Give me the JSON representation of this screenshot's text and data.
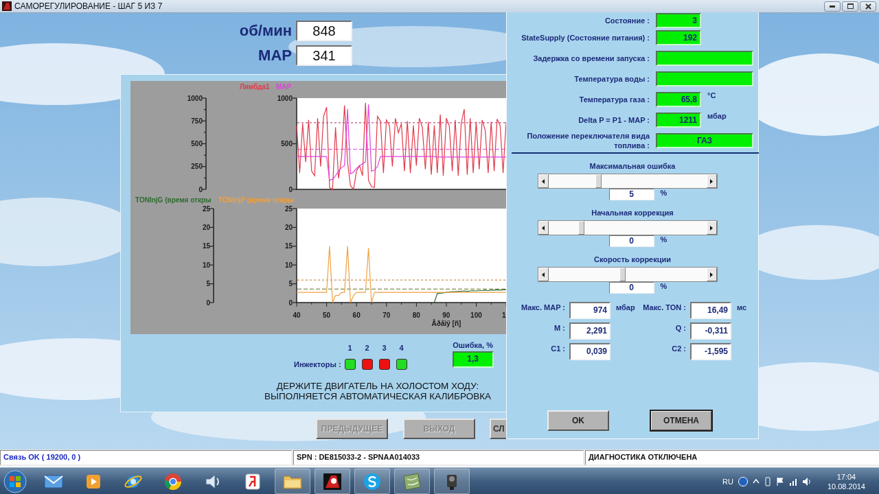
{
  "window": {
    "title": "САМОРЕГУЛИРОВАНИЕ - ШАГ 5 ИЗ 7"
  },
  "readouts": [
    {
      "label": "об/мин",
      "value": "848"
    },
    {
      "label": "MAP",
      "value": "341"
    }
  ],
  "charts": [
    {
      "left_axis": [
        "1000",
        "750",
        "500",
        "250",
        "0"
      ],
      "chart_data": {
        "type": "line",
        "xlim": [
          40,
          110
        ],
        "ylim": [
          0,
          1000
        ],
        "yticks": [
          0,
          500,
          1000
        ],
        "ref_lines": [
          {
            "axis": "y",
            "value": 730,
            "color": "#b02060"
          },
          {
            "axis": "y",
            "value": 440,
            "color": "#e040e0"
          }
        ],
        "x": [
          40,
          41,
          42,
          43,
          44,
          45,
          46,
          47,
          48,
          49,
          50,
          51,
          52,
          53,
          54,
          55,
          56,
          57,
          58,
          59,
          60,
          61,
          62,
          63,
          64,
          65,
          66,
          67,
          68,
          69,
          70,
          71,
          72,
          73,
          74,
          75,
          76,
          77,
          78,
          79,
          80,
          81,
          82,
          83,
          84,
          85,
          86,
          87,
          88,
          89,
          90,
          91,
          92,
          93,
          94,
          95,
          96,
          97,
          98,
          99,
          100,
          101,
          102,
          103,
          104,
          105,
          106,
          107,
          108,
          109,
          110
        ],
        "series": [
          {
            "name": "Лямбда1",
            "color": "#e03a4a",
            "values": [
              700,
              180,
              720,
              300,
              760,
              200,
              150,
              780,
              250,
              800,
              900,
              20,
              0,
              680,
              120,
              350,
              920,
              300,
              40,
              0,
              200,
              260,
              150,
              950,
              100,
              30,
              20,
              800,
              750,
              180,
              760,
              700,
              250,
              780,
              620,
              720,
              200,
              750,
              180,
              700,
              260,
              780,
              680,
              220,
              740,
              160,
              700,
              180,
              820,
              150,
              780,
              700,
              200,
              760,
              150,
              720,
              880,
              160,
              780,
              180,
              740,
              220,
              760,
              650,
              180,
              740,
              200,
              770,
              700,
              180,
              740
            ]
          },
          {
            "name": "MAP",
            "color": "#e040e0",
            "values": [
              360,
              360,
              360,
              360,
              360,
              360,
              360,
              360,
              360,
              360,
              360,
              100,
              110,
              150,
              200,
              240,
              260,
              880,
              170,
              190,
              230,
              260,
              280,
              300,
              930,
              200,
              210,
              250,
              360,
              360,
              360,
              360,
              360,
              360,
              360,
              360,
              360,
              360,
              360,
              360,
              360,
              360,
              360,
              360,
              360,
              360,
              360,
              355,
              355,
              355,
              355,
              355,
              355,
              355,
              355,
              355,
              355,
              355,
              355,
              355,
              355,
              355,
              355,
              355,
              355,
              355,
              355,
              355,
              355,
              355,
              355
            ]
          }
        ]
      }
    },
    {
      "left_axis": [
        "25",
        "20",
        "15",
        "10",
        "5",
        "0"
      ],
      "cut_tick_label": "1",
      "chart_data": {
        "type": "line",
        "xlabel": "Âðåìÿ [ñ]",
        "xlim": [
          40,
          110
        ],
        "ylim": [
          0,
          25
        ],
        "yticks": [
          0,
          5,
          10,
          15,
          20,
          25
        ],
        "ref_lines": [
          {
            "axis": "y",
            "value": 6,
            "color": "#c07020"
          },
          {
            "axis": "y",
            "value": 3.6,
            "color": "#607020"
          }
        ],
        "xticks": [
          40,
          50,
          60,
          70,
          80,
          90,
          100
        ],
        "x": [
          40,
          41,
          42,
          43,
          44,
          45,
          46,
          47,
          48,
          49,
          50,
          51,
          52,
          53,
          54,
          55,
          56,
          57,
          58,
          59,
          60,
          61,
          62,
          63,
          64,
          65,
          66,
          67,
          68,
          69,
          70,
          71,
          72,
          73,
          74,
          75,
          76,
          77,
          78,
          79,
          80,
          81,
          82,
          83,
          84,
          85,
          86,
          87,
          88,
          89,
          90,
          91,
          92,
          93,
          94,
          95,
          96,
          97,
          98,
          99,
          100,
          101,
          102,
          103,
          104,
          105,
          106,
          107,
          108,
          109,
          110
        ],
        "series": [
          {
            "name": "TONInjG (время откры",
            "color": "#2e6b2e",
            "values": [
              null,
              null,
              null,
              null,
              null,
              null,
              null,
              null,
              null,
              null,
              null,
              null,
              null,
              null,
              null,
              null,
              null,
              null,
              null,
              null,
              null,
              null,
              null,
              null,
              null,
              null,
              null,
              null,
              null,
              null,
              null,
              null,
              null,
              null,
              null,
              null,
              null,
              null,
              null,
              null,
              null,
              null,
              null,
              null,
              null,
              null,
              0,
              2.4,
              2.5,
              2.6,
              2.7,
              2.8,
              2.9,
              2.9,
              3,
              3,
              3.1,
              3,
              3.1,
              3.2,
              3.1,
              3.2,
              3.2,
              3.3,
              3.2,
              3.3,
              3.3,
              3.4,
              3.3,
              3.4,
              3.4
            ]
          },
          {
            "name": "TONInjP (время откры",
            "color": "#f0a040",
            "values": [
              2.7,
              2.7,
              2.7,
              2.7,
              2.7,
              2.7,
              2.7,
              2.7,
              2.7,
              2.7,
              2.7,
              15,
              0,
              1.9,
              1.9,
              2.7,
              2.7,
              15,
              0,
              1.9,
              2.7,
              2.7,
              2.7,
              2.7,
              14.5,
              0,
              2.7,
              2.7,
              2.7,
              2.7,
              2.7,
              2.7,
              2.7,
              2.7,
              2.7,
              2.7,
              2.7,
              2.7,
              2.7,
              2.7,
              2.7,
              2.7,
              2.7,
              2.7,
              2.7,
              2.7,
              2.7,
              2.7,
              2.7,
              2.7,
              2.7,
              2.7,
              2.7,
              2.7,
              2.7,
              2.7,
              2.7,
              2.7,
              2.7,
              2.7,
              2.7,
              2.7,
              2.7,
              2.7,
              2.7,
              2.7,
              2.7,
              2.7,
              2.7,
              2.7,
              2.7
            ]
          }
        ]
      }
    }
  ],
  "injectors": {
    "label": "Инжекторы :",
    "items": [
      {
        "number": "1",
        "color": "#22dd22"
      },
      {
        "number": "2",
        "color": "#ee1111"
      },
      {
        "number": "3",
        "color": "#ee1111"
      },
      {
        "number": "4",
        "color": "#22dd22"
      }
    ]
  },
  "error": {
    "label": "Ошибка, %",
    "value": "1,3"
  },
  "message": "ДЕРЖИТЕ ДВИГАТЕЛЬ НА ХОЛОСТОМ ХОДУ:\nВЫПОЛНЯЕТСЯ АВТОМАТИЧЕСКАЯ КАЛИБРОВКА",
  "nav_buttons": [
    {
      "label": "ПРЕДЫДУЩЕЕ",
      "disabled": true
    },
    {
      "label": "ВЫХОД",
      "disabled": true
    },
    {
      "label": "СЛ",
      "disabled": false
    }
  ],
  "dialog": {
    "fields": [
      {
        "label": "Состояние :",
        "value": "3",
        "kind": "short"
      },
      {
        "label": "StateSupply (Состояние питания) :",
        "value": "192",
        "kind": "short"
      },
      {
        "label": "Задержка со времени запуска :",
        "kind": "long"
      },
      {
        "label": "Температура воды :",
        "kind": "long"
      },
      {
        "label": "Температура газа :",
        "value": "65,8",
        "unit": "°C",
        "kind": "short"
      },
      {
        "label": "Delta P = P1 - MAP :",
        "value": "1211",
        "unit": "мбар",
        "kind": "short"
      },
      {
        "label": "Положение переключателя вида топлива :",
        "value": "ГАЗ",
        "kind": "long"
      }
    ],
    "sliders": [
      {
        "label": "Максимальная ошибка",
        "value": "5",
        "unit": "%"
      },
      {
        "label": "Начальная коррекция",
        "value": "0",
        "unit": "%"
      },
      {
        "label": "Скорость коррекции",
        "value": "0",
        "unit": "%"
      }
    ],
    "params": [
      {
        "label": "Макс. MAP :",
        "value": "974",
        "unit": "мбар"
      },
      {
        "label": "Макс. TON :",
        "value": "16,49",
        "unit": "мс"
      },
      {
        "label": "M :",
        "value": "2,291"
      },
      {
        "label": "Q :",
        "value": "-0,311"
      },
      {
        "label": "C1 :",
        "value": "0,039"
      },
      {
        "label": "C2 :",
        "value": "-1,595"
      }
    ],
    "buttons": [
      {
        "label": "OK",
        "focused": false
      },
      {
        "label": "ОТМЕНА",
        "focused": true
      }
    ]
  },
  "status_bar": [
    "Связь OK ( 19200,  0 )",
    "SPN : DE815033-2 - SPNAA014033",
    "ДИАГНОСТИКА ОТКЛЮЧЕНА"
  ],
  "taskbar": {
    "language": "RU",
    "time": "17:04",
    "date": "10.08.2014"
  }
}
